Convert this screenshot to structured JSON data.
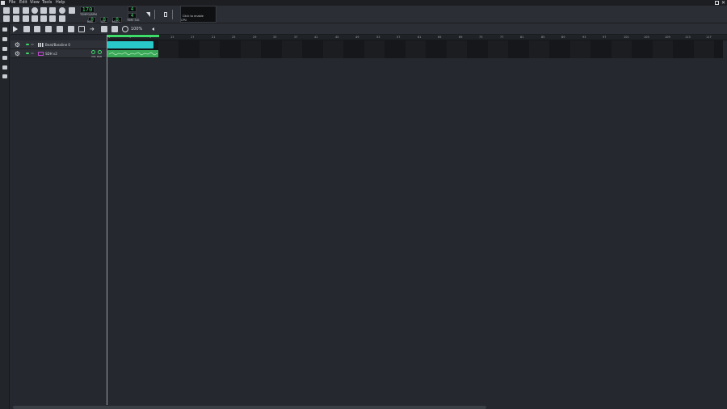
{
  "menu": {
    "items": [
      "File",
      "Edit",
      "View",
      "Tools",
      "Help"
    ]
  },
  "transport": {
    "tempo_value": "170",
    "tempo_label": "TEMPO/BPM",
    "min_value": "0",
    "sec_value": "0",
    "msec_value": "0",
    "min_label": "MIN",
    "sec_label": "SEC",
    "msec_label": "MSEC",
    "timesig_num": "4",
    "timesig_den": "4",
    "timesig_label": "TIME SIG",
    "cpu_hint": "Click to enable",
    "cpu_label": "CPU"
  },
  "song_editor": {
    "zoom_value": "100%",
    "bars": [
      "1",
      "5",
      "9",
      "13",
      "17",
      "21",
      "25",
      "29",
      "33",
      "37",
      "41",
      "45",
      "49",
      "53",
      "57",
      "61",
      "65",
      "69",
      "73",
      "77",
      "81",
      "85",
      "89",
      "93",
      "97",
      "101",
      "105",
      "109",
      "113",
      "117"
    ],
    "tracks": [
      {
        "name": "Beat/Bassline 0",
        "type": "bb"
      },
      {
        "name": "SDH v2",
        "type": "instrument",
        "knob_label": "VOL PAN"
      }
    ]
  },
  "colors": {
    "accent_green": "#3fdc6b",
    "bb_clip": "#29c9c9",
    "instrument_clip": "#3aaa58"
  }
}
